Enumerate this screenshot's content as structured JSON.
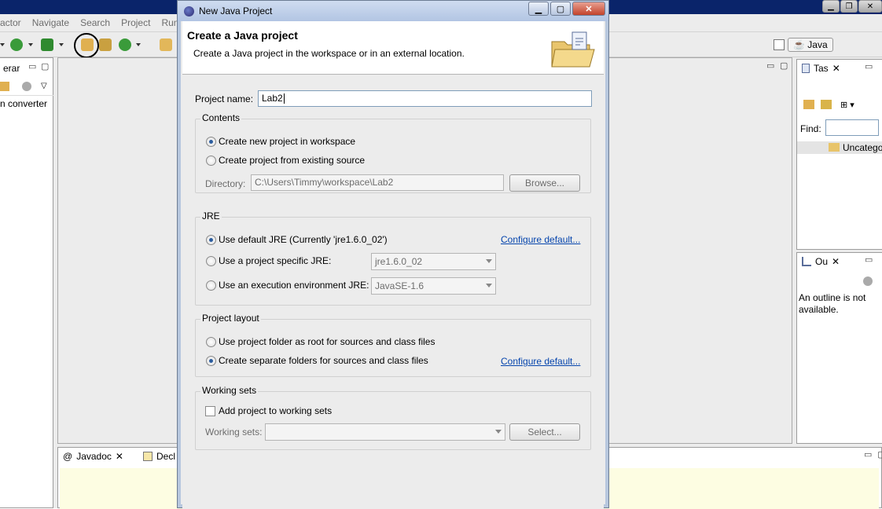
{
  "menu": [
    "actor",
    "Navigate",
    "Search",
    "Project",
    "Run"
  ],
  "perspective": {
    "label": "Java"
  },
  "left_view": {
    "tab_label": "erar",
    "item": "n converter"
  },
  "bottom_view": {
    "javadoc_tab": "Javadoc",
    "declaration_tab": "Decl"
  },
  "tasks_view": {
    "tab_label": "Tas",
    "find_label": "Find:",
    "category": "Uncatego"
  },
  "outline_view": {
    "tab_label": "Ou",
    "message": "An outline is not available."
  },
  "dialog": {
    "title": "New Java Project",
    "header": "Create a Java project",
    "subheader": "Create a Java project in the workspace or in an external location.",
    "project_name_label": "Project name:",
    "project_name_value": "Lab2",
    "contents": {
      "title": "Contents",
      "option_new": "Create new project in workspace",
      "option_existing": "Create project from existing source",
      "directory_label": "Directory:",
      "directory_value": "C:\\Users\\Timmy\\workspace\\Lab2",
      "browse": "Browse..."
    },
    "jre": {
      "title": "JRE",
      "option_default": "Use default JRE (Currently 'jre1.6.0_02')",
      "configure_link": "Configure default...",
      "option_specific": "Use a project specific JRE:",
      "specific_value": "jre1.6.0_02",
      "option_env": "Use an execution environment JRE:",
      "env_value": "JavaSE-1.6"
    },
    "layout": {
      "title": "Project layout",
      "option_root": "Use project folder as root for sources and class files",
      "option_separate": "Create separate folders for sources and class files",
      "configure_link": "Configure default..."
    },
    "working_sets": {
      "title": "Working sets",
      "checkbox_label": "Add project to working sets",
      "sets_label": "Working sets:",
      "select": "Select..."
    }
  }
}
